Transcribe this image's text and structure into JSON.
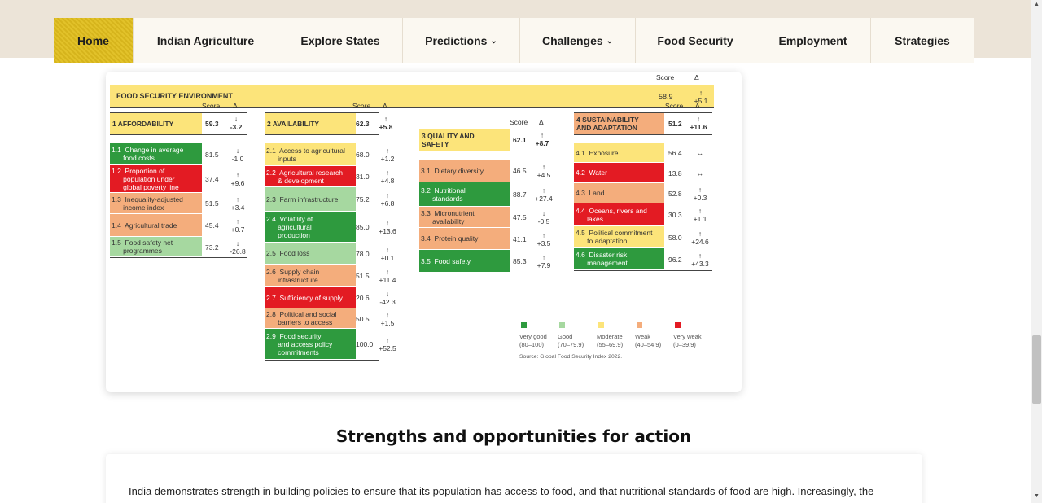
{
  "nav": {
    "items": [
      {
        "label": "Home",
        "active": true
      },
      {
        "label": "Indian Agriculture"
      },
      {
        "label": "Explore States"
      },
      {
        "label": "Predictions",
        "dropdown": true
      },
      {
        "label": "Challenges",
        "dropdown": true
      },
      {
        "label": "Food Security"
      },
      {
        "label": "Employment"
      },
      {
        "label": "Strategies"
      }
    ],
    "chevron": "⌄",
    "active_color": "#dcbc22"
  },
  "figure": {
    "col_score": "Score",
    "col_delta": "Δ",
    "header": {
      "title": "FOOD SECURITY ENVIRONMENT",
      "score": "58.9",
      "arrow": "↑",
      "delta": "+5.1"
    },
    "colors": {
      "very_good": "#2e9a3e",
      "good": "#a6d8a0",
      "moderate": "#fce47a",
      "weak": "#f4ad7c",
      "very_weak": "#e31b23"
    },
    "pillars": [
      {
        "num": "1",
        "name": "AFFORDABILITY",
        "score": "59.3",
        "arrow": "↓",
        "delta": "-3.2",
        "head_color": "moderate",
        "rows": [
          {
            "name": "1.1  Change in average\n      food costs",
            "score": "81.5",
            "arrow": "↓",
            "delta": "-1.0",
            "color": "very_good"
          },
          {
            "name": "1.2  Proportion of\n      population under\n      global poverty line",
            "score": "37.4",
            "arrow": "↑",
            "delta": "+9.6",
            "color": "very_weak"
          },
          {
            "name": "1.3  Inequality-adjusted\n      income index",
            "score": "51.5",
            "arrow": "↑",
            "delta": "+3.4",
            "color": "weak"
          },
          {
            "name": "1.4  Agricultural trade",
            "score": "45.4",
            "arrow": "↑",
            "delta": "+0.7",
            "color": "weak"
          },
          {
            "name": "1.5  Food safety net\n      programmes",
            "score": "73.2",
            "arrow": "↓",
            "delta": "-26.8",
            "color": "good"
          }
        ]
      },
      {
        "num": "2",
        "name": "AVAILABILITY",
        "score": "62.3",
        "arrow": "↑",
        "delta": "+5.8",
        "head_color": "moderate",
        "rows": [
          {
            "name": "2.1  Access to agricultural\n      inputs",
            "score": "68.0",
            "arrow": "↑",
            "delta": "+1.2",
            "color": "moderate"
          },
          {
            "name": "2.2  Agricultural research\n      & development",
            "score": "31.0",
            "arrow": "↑",
            "delta": "+4.8",
            "color": "very_weak"
          },
          {
            "name": "2.3  Farm infrastructure",
            "score": "75.2",
            "arrow": "↑",
            "delta": "+6.8",
            "color": "good"
          },
          {
            "name": "2.4  Volatility of\n      agricultural\n      production",
            "score": "85.0",
            "arrow": "↑",
            "delta": "+13.6",
            "color": "very_good"
          },
          {
            "name": "2.5  Food loss",
            "score": "78.0",
            "arrow": "↑",
            "delta": "+0.1",
            "color": "good"
          },
          {
            "name": "2.6  Supply chain\n      infrastructure",
            "score": "51.5",
            "arrow": "↑",
            "delta": "+11.4",
            "color": "weak"
          },
          {
            "name": "2.7  Sufficiency of supply",
            "score": "20.6",
            "arrow": "↓",
            "delta": "-42.3",
            "color": "very_weak"
          },
          {
            "name": "2.8  Political and social\n      barriers to access",
            "score": "50.5",
            "arrow": "↑",
            "delta": "+1.5",
            "color": "weak"
          },
          {
            "name": "2.9  Food security\n      and access policy\n      commitments",
            "score": "100.0",
            "arrow": "↑",
            "delta": "+52.5",
            "color": "very_good"
          }
        ]
      },
      {
        "num": "3",
        "name": "QUALITY AND\nSAFETY",
        "score": "62.1",
        "arrow": "↑",
        "delta": "+8.7",
        "head_color": "moderate",
        "rows": [
          {
            "name": "3.1  Dietary diversity",
            "score": "46.5",
            "arrow": "↑",
            "delta": "+4.5",
            "color": "weak"
          },
          {
            "name": "3.2  Nutritional\n      standards",
            "score": "88.7",
            "arrow": "↑",
            "delta": "+27.4",
            "color": "very_good"
          },
          {
            "name": "3.3  Micronutrient\n      availability",
            "score": "47.5",
            "arrow": "↓",
            "delta": "-0.5",
            "color": "weak"
          },
          {
            "name": "3.4  Protein quality",
            "score": "41.1",
            "arrow": "↑",
            "delta": "+3.5",
            "color": "weak"
          },
          {
            "name": "3.5  Food safety",
            "score": "85.3",
            "arrow": "↑",
            "delta": "+7.9",
            "color": "very_good"
          }
        ]
      },
      {
        "num": "4",
        "name": "SUSTAINABILITY\nAND ADAPTATION",
        "score": "51.2",
        "arrow": "↑",
        "delta": "+11.6",
        "head_color": "weak",
        "rows": [
          {
            "name": "4.1  Exposure",
            "score": "56.4",
            "arrow": "↔",
            "delta": "",
            "color": "moderate"
          },
          {
            "name": "4.2  Water",
            "score": "13.8",
            "arrow": "↔",
            "delta": "",
            "color": "very_weak"
          },
          {
            "name": "4.3  Land",
            "score": "52.8",
            "arrow": "↑",
            "delta": "+0.3",
            "color": "weak"
          },
          {
            "name": "4.4  Oceans, rivers and\n      lakes",
            "score": "30.3",
            "arrow": "↑",
            "delta": "+1.1",
            "color": "very_weak"
          },
          {
            "name": "4.5  Political commitment\n      to adaptation",
            "score": "58.0",
            "arrow": "↑",
            "delta": "+24.6",
            "color": "moderate"
          },
          {
            "name": "4.6  Disaster risk\n      management",
            "score": "96.2",
            "arrow": "↑",
            "delta": "+43.3",
            "color": "very_good"
          }
        ]
      }
    ],
    "legend": [
      {
        "label": "Very good\n(80–100)",
        "color": "very_good"
      },
      {
        "label": "Good\n(70–79.9)",
        "color": "good"
      },
      {
        "label": "Moderate\n(55–69.9)",
        "color": "moderate"
      },
      {
        "label": "Weak\n(40–54.9)",
        "color": "weak"
      },
      {
        "label": "Very weak\n(0–39.9)",
        "color": "very_weak"
      }
    ],
    "source": "Source: Global Food Security Index 2022."
  },
  "section": {
    "title": "Strengths and opportunities for action",
    "paragraph": "India demonstrates strength in building policies to ensure that its population has access to food, and that nutritional standards of food are high. Increasingly, the"
  },
  "scrollbar": {
    "up": "▲",
    "down": "▼"
  }
}
